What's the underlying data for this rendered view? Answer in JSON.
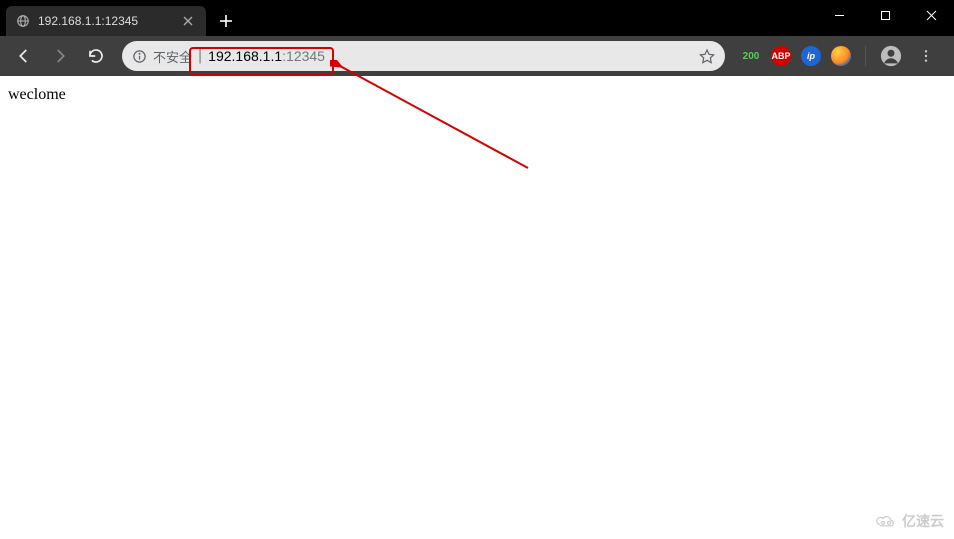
{
  "window": {
    "tab": {
      "title": "192.168.1.1:12345"
    }
  },
  "toolbar": {
    "insecure_label": "不安全",
    "url_host": "192.168.1.1",
    "url_port": ":12345"
  },
  "extensions": {
    "status_badge": "200",
    "abp_label": "ABP",
    "ip_label": "ip"
  },
  "page": {
    "body_text": "weclome"
  },
  "watermark": {
    "text": "亿速云"
  }
}
